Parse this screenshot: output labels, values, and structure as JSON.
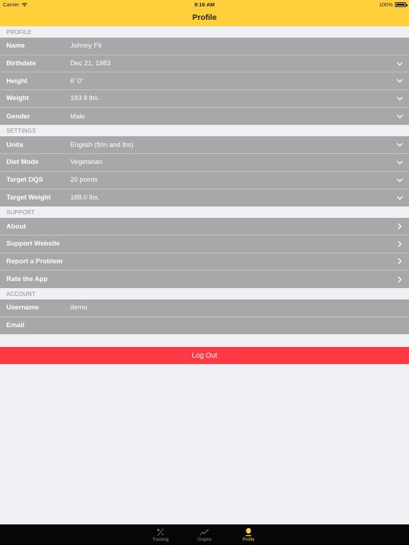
{
  "status": {
    "carrier": "Carrier",
    "time": "9:16 AM",
    "battery": "100%"
  },
  "nav": {
    "title": "Profile"
  },
  "sections": [
    {
      "header": "PROFILE",
      "rows": [
        {
          "label": "Name",
          "value": "Johnny Fit",
          "accessory": "none"
        },
        {
          "label": "Birthdate",
          "value": "Dec 21, 1983",
          "accessory": "chevron-down"
        },
        {
          "label": "Height",
          "value": "6' 0\"",
          "accessory": "chevron-down"
        },
        {
          "label": "Weight",
          "value": "193.9 lbs.",
          "accessory": "chevron-down"
        },
        {
          "label": "Gender",
          "value": "Male",
          "accessory": "chevron-down"
        }
      ]
    },
    {
      "header": "SETTINGS",
      "rows": [
        {
          "label": "Units",
          "value": "English (ft/in and lbs)",
          "accessory": "chevron-down"
        },
        {
          "label": "Diet Mode",
          "value": "Vegetarian",
          "accessory": "chevron-down"
        },
        {
          "label": "Target DQS",
          "value": "20 points",
          "accessory": "chevron-down"
        },
        {
          "label": "Target Weight",
          "value": "188.0 lbs.",
          "accessory": "chevron-down"
        }
      ]
    },
    {
      "header": "SUPPORT",
      "rows": [
        {
          "label": "About",
          "value": "",
          "accessory": "chevron-right"
        },
        {
          "label": "Support Website",
          "value": "",
          "accessory": "chevron-right"
        },
        {
          "label": "Report a Problem",
          "value": "",
          "accessory": "chevron-right"
        },
        {
          "label": "Rate the App",
          "value": "",
          "accessory": "chevron-right"
        }
      ]
    },
    {
      "header": "ACCOUNT",
      "rows": [
        {
          "label": "Username",
          "value": "demo",
          "accessory": "none"
        },
        {
          "label": "Email",
          "value": "",
          "accessory": "none"
        }
      ]
    }
  ],
  "logout_label": "Log Out",
  "tabs": [
    {
      "label": "Tracking",
      "icon": "plus-minus-icon",
      "active": false
    },
    {
      "label": "Graphs",
      "icon": "line-graph-icon",
      "active": false
    },
    {
      "label": "Profile",
      "icon": "person-icon",
      "active": true
    }
  ],
  "colors": {
    "accent": "#ffd03a",
    "row_background": "#a8a8a8",
    "logout": "#ff3a44",
    "tab_bar": "#060606"
  }
}
